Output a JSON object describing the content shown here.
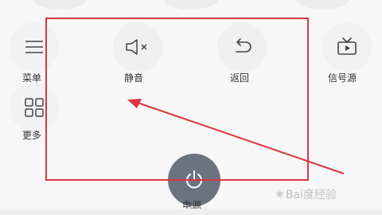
{
  "remote": {
    "menu": {
      "label": "菜单",
      "icon": "menu-icon"
    },
    "mute": {
      "label": "静音",
      "icon": "mute-icon"
    },
    "back": {
      "label": "返回",
      "icon": "back-icon"
    },
    "source": {
      "label": "信号源",
      "icon": "tv-source-icon"
    },
    "more": {
      "label": "更多",
      "icon": "grid-icon"
    },
    "power": {
      "label": "电源",
      "icon": "power-icon"
    }
  },
  "annotation": {
    "box_color": "#d9363e",
    "arrow_color": "#d9363e"
  },
  "watermark": {
    "text": "Bai度经验"
  },
  "colors": {
    "power_button": "#6b7280",
    "background": "#f7f7f7"
  }
}
